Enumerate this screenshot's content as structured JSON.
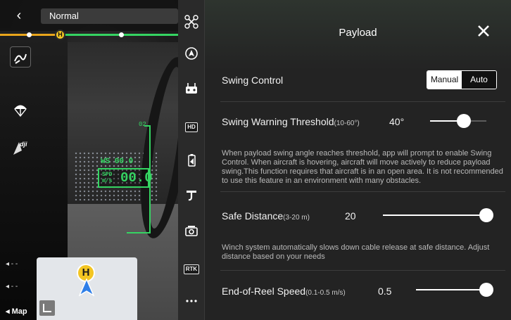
{
  "topbar": {
    "back_glyph": "‹",
    "flight_mode": "Normal"
  },
  "hud": {
    "ws_text": "WS 00.0",
    "spd_label_top": "SPD",
    "spd_label_bottom": "m/s",
    "spd_value": "00.0",
    "tick_label": "02"
  },
  "left_panel": {
    "dash_1": "◂ - -",
    "dash_2": "◂ - -",
    "map_label": "◂ Map",
    "home_marker": "H",
    "minimap_home": "H"
  },
  "icon_column": {
    "items": [
      {
        "icon": "drone-icon"
      },
      {
        "icon": "obstacle-avoidance-icon"
      },
      {
        "icon": "remote-controller-icon"
      },
      {
        "icon": "hd-transmission-icon",
        "text": "HD"
      },
      {
        "icon": "battery-icon"
      },
      {
        "icon": "winch-payload-icon"
      },
      {
        "icon": "camera-icon"
      },
      {
        "icon": "rtk-icon",
        "text": "RTK"
      },
      {
        "icon": "more-icon"
      }
    ]
  },
  "panel": {
    "title": "Payload",
    "swing_control": {
      "label": "Swing Control",
      "options": [
        "Manual",
        "Auto"
      ],
      "selected": "Manual"
    },
    "swing_warning": {
      "label": "Swing Warning Threshold",
      "hint": "(10-60°)",
      "value_text": "40°",
      "min": 10,
      "max": 60,
      "value": 40,
      "description": "When payload swing angle reaches threshold, app will prompt to enable Swing Control. When aircraft is hovering, aircraft will move actively to reduce payload swing.This function requires that aircraft is in an open area. It is not recommended to use this feature in an environment with many obstacles."
    },
    "safe_distance": {
      "label": "Safe Distance",
      "hint": "(3-20 m)",
      "value_text": "20",
      "min": 3,
      "max": 20,
      "value": 20,
      "description": "Winch system automatically slows down cable release at safe distance. Adjust distance based on your needs"
    },
    "end_of_reel": {
      "label": "End-of-Reel Speed",
      "hint": "(0.1-0.5 m/s)",
      "value_text": "0.5",
      "min": 0.1,
      "max": 0.5,
      "value": 0.5
    }
  },
  "colors": {
    "hud_green": "#35d462",
    "home_yellow": "#f3c522",
    "route_orange": "#e9a51b",
    "panel_bg": "#232323"
  }
}
